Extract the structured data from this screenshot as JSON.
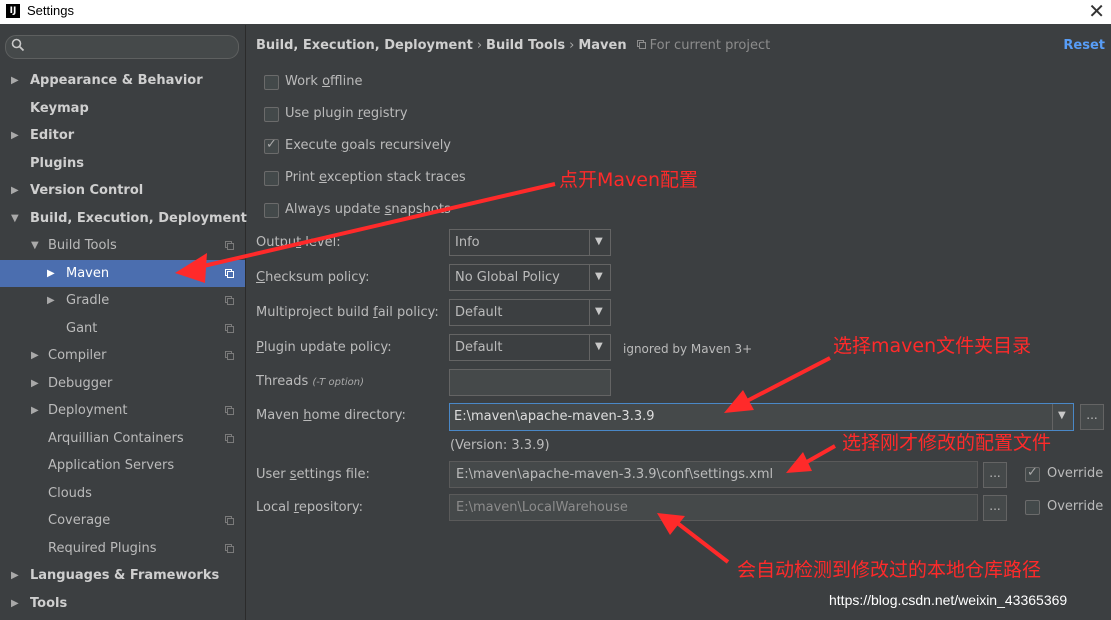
{
  "window": {
    "title": "Settings",
    "logo_text": "IJ"
  },
  "search": {
    "placeholder": ""
  },
  "tree": [
    {
      "label": "Appearance & Behavior",
      "bold": true,
      "arrow": "▶",
      "indent": 0
    },
    {
      "label": "Keymap",
      "bold": true,
      "arrow": "",
      "indent": 0
    },
    {
      "label": "Editor",
      "bold": true,
      "arrow": "▶",
      "indent": 0
    },
    {
      "label": "Plugins",
      "bold": true,
      "arrow": "",
      "indent": 0
    },
    {
      "label": "Version Control",
      "bold": true,
      "arrow": "▶",
      "indent": 0
    },
    {
      "label": "Build, Execution, Deployment",
      "bold": true,
      "arrow": "▼",
      "indent": 0
    },
    {
      "label": "Build Tools",
      "bold": false,
      "arrow": "▼",
      "indent": 1,
      "copy": true
    },
    {
      "label": "Maven",
      "bold": false,
      "arrow": "▶",
      "indent": 2,
      "copy": true,
      "selected": true
    },
    {
      "label": "Gradle",
      "bold": false,
      "arrow": "▶",
      "indent": 2,
      "copy": true
    },
    {
      "label": "Gant",
      "bold": false,
      "arrow": "",
      "indent": 2,
      "copy": true
    },
    {
      "label": "Compiler",
      "bold": false,
      "arrow": "▶",
      "indent": 1,
      "copy": true
    },
    {
      "label": "Debugger",
      "bold": false,
      "arrow": "▶",
      "indent": 1
    },
    {
      "label": "Deployment",
      "bold": false,
      "arrow": "▶",
      "indent": 1,
      "copy": true
    },
    {
      "label": "Arquillian Containers",
      "bold": false,
      "arrow": "",
      "indent": 1,
      "copy": true
    },
    {
      "label": "Application Servers",
      "bold": false,
      "arrow": "",
      "indent": 1
    },
    {
      "label": "Clouds",
      "bold": false,
      "arrow": "",
      "indent": 1
    },
    {
      "label": "Coverage",
      "bold": false,
      "arrow": "",
      "indent": 1,
      "copy": true
    },
    {
      "label": "Required Plugins",
      "bold": false,
      "arrow": "",
      "indent": 1,
      "copy": true
    },
    {
      "label": "Languages & Frameworks",
      "bold": true,
      "arrow": "▶",
      "indent": 0
    },
    {
      "label": "Tools",
      "bold": true,
      "arrow": "▶",
      "indent": 0
    }
  ],
  "breadcrumb": {
    "items": [
      "Build, Execution, Deployment",
      "Build Tools",
      "Maven"
    ],
    "separator": "›",
    "scope": "For current project"
  },
  "reset_label": "Reset",
  "checkboxes": {
    "work_offline": {
      "pre": "Work ",
      "u": "o",
      "post": "ffline",
      "checked": false
    },
    "use_plugin_registry": {
      "pre": "Use plugin ",
      "u": "r",
      "post": "egistry",
      "checked": false
    },
    "execute_goals": {
      "pre": "Execute ",
      "u": "g",
      "post": "oals recursively",
      "checked": true
    },
    "print_exception": {
      "pre": "Print ",
      "u": "e",
      "post": "xception stack traces",
      "checked": false
    },
    "always_update": {
      "pre": "Always update ",
      "u": "s",
      "post": "napshots",
      "checked": false
    }
  },
  "fields": {
    "output_level": {
      "pre": "Outpu",
      "u": "t",
      "post": " level:",
      "value": "Info"
    },
    "checksum_policy": {
      "pre": "",
      "u": "C",
      "post": "hecksum policy:",
      "value": "No Global Policy"
    },
    "multiproject": {
      "pre": "Multiproject build ",
      "u": "f",
      "post": "ail policy:",
      "value": "Default"
    },
    "plugin_update": {
      "pre": "",
      "u": "P",
      "post": "lugin update policy:",
      "value": "Default",
      "note": "ignored by Maven 3+"
    },
    "threads": {
      "label": "Threads",
      "hint": "(-T option)",
      "value": ""
    },
    "maven_home": {
      "pre": "Maven ",
      "u": "h",
      "post": "ome directory:",
      "value": "E:\\maven\\apache-maven-3.3.9",
      "version": "(Version: 3.3.9)"
    },
    "user_settings": {
      "pre": "User ",
      "u": "s",
      "post": "ettings file:",
      "value": "E:\\maven\\apache-maven-3.3.9\\conf\\settings.xml",
      "override": true
    },
    "local_repo": {
      "pre": "Local ",
      "u": "r",
      "post": "epository:",
      "value": "E:\\maven\\LocalWarehouse",
      "override": false
    }
  },
  "override_label": "Override",
  "browse_label": "...",
  "annotations": {
    "open_maven": "点开Maven配置",
    "choose_dir": "选择maven文件夹目录",
    "choose_settings": "选择刚才修改的配置文件",
    "auto_detect": "会自动检测到修改过的本地仓库路径"
  },
  "watermark": "https://blog.csdn.net/weixin_43365369",
  "colors": {
    "accent": "#4b6eaf",
    "link": "#589df6",
    "annotation": "#ff2a2a",
    "background": "#3c3f41"
  }
}
